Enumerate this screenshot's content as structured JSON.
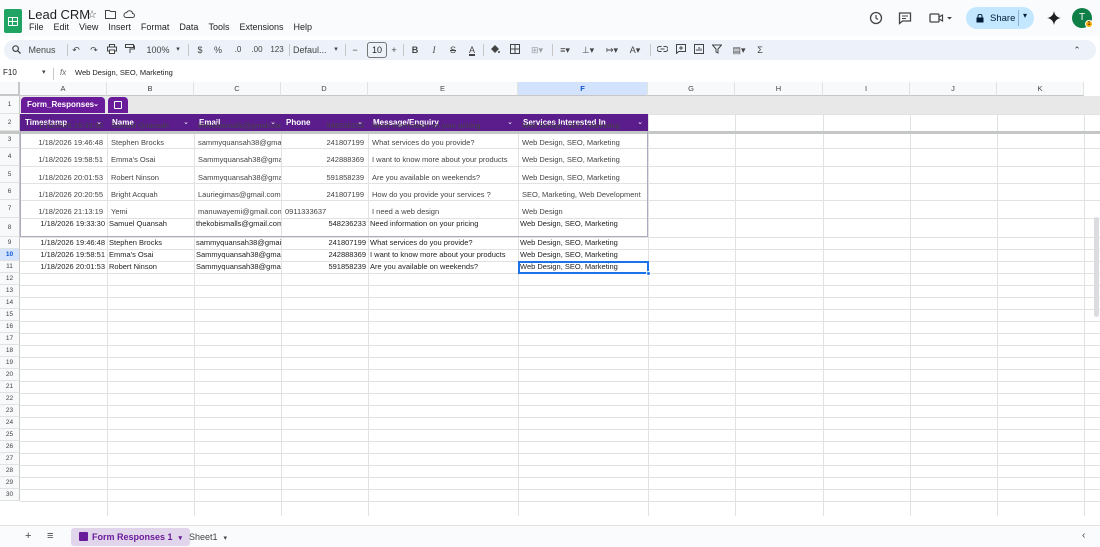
{
  "app": {
    "doc_title": "Lead CRM",
    "menu": [
      "File",
      "Edit",
      "View",
      "Insert",
      "Format",
      "Data",
      "Tools",
      "Extensions",
      "Help"
    ],
    "share_label": "Share",
    "avatar_letter": "T",
    "avatar_badge": "1"
  },
  "toolbar": {
    "menus_label": "Menus",
    "zoom": "100%",
    "currency": "$",
    "percent": "%",
    "dec_decrease": ".0",
    "dec_increase": ".00",
    "number_format": "123",
    "font_name": "Defaul...",
    "font_size": "10",
    "bold": "B",
    "italic": "I",
    "strike": "S",
    "text_color": "A",
    "sum": "Σ"
  },
  "formula_bar": {
    "cell_ref": "F10",
    "fx": "fx",
    "value": "Web Design, SEO, Marketing"
  },
  "columns": [
    "A",
    "B",
    "C",
    "D",
    "E",
    "F",
    "G",
    "H",
    "I",
    "J",
    "K"
  ],
  "selected_column": "F",
  "selected_row": "10",
  "table": {
    "name": "Form_Responses",
    "headers": [
      "Timestamp",
      "Name",
      "Email",
      "Phone",
      "Message/Enquiry",
      "Services Interested In"
    ],
    "rows": [
      [
        "1/18/2026 19:33:30",
        "Samuel Quansah",
        "thekobismalls@gmail.com",
        "548236233",
        "Need information on your pricing",
        "Web Design, SEO, Marketing"
      ],
      [
        "1/18/2026 19:46:48",
        "Stephen Brocks",
        "sammyquansah38@gmail.com",
        "241807199",
        "What services do you provide?",
        "Web Design, SEO, Marketing"
      ],
      [
        "1/18/2026 19:58:51",
        "Emma's Osai",
        "Sammyquansah38@gmail.com",
        "242888369",
        "I want to know more about your products",
        "Web Design, SEO, Marketing"
      ],
      [
        "1/18/2026 20:01:53",
        "Robert Ninson",
        "Sammyquansah38@gmail.com",
        "591858239",
        "Are you available on weekends?",
        "Web Design, SEO, Marketing"
      ],
      [
        "1/18/2026 20:20:55",
        "Bright Acquah",
        "Lauriegimas@gmail.com",
        "241807199",
        "How do you provide your services ?",
        "SEO, Marketing, Web Development"
      ],
      [
        "1/18/2026 21:13:19",
        "Yemi",
        "manuwayemi@gmail.com",
        "0911333637",
        "I need a web design",
        "Web Design"
      ]
    ]
  },
  "plain_rows": [
    [
      "1/18/2026 19:33:30",
      "Samuel Quansah",
      "thekobismalls@gmail.com",
      "548236233",
      "Need information on your pricing",
      "Web Design, SEO, Marketing"
    ],
    [
      "1/18/2026 19:46:48",
      "Stephen Brocks",
      "sammyquansah38@gmail.com",
      "241807199",
      "What services do you provide?",
      "Web Design, SEO, Marketing"
    ],
    [
      "1/18/2026 19:58:51",
      "Emma's Osai",
      "Sammyquansah38@gmail.com",
      "242888369",
      "I want to know more about your products",
      "Web Design, SEO, Marketing"
    ],
    [
      "1/18/2026 20:01:53",
      "Robert Ninson",
      "Sammyquansah38@gmail.com",
      "591858239",
      "Are you available on weekends?",
      "Web Design, SEO, Marketing"
    ]
  ],
  "row_numbers": [
    "1",
    "2",
    "3",
    "4",
    "5",
    "6",
    "7",
    "8",
    "9",
    "10",
    "11",
    "12",
    "13",
    "14",
    "15",
    "16",
    "17",
    "18",
    "19",
    "20",
    "21",
    "22",
    "23",
    "24",
    "25",
    "26",
    "27",
    "28",
    "29",
    "30"
  ],
  "sheets": {
    "add": "+",
    "list": "≡",
    "tabs": [
      "Form Responses 1",
      "Sheet1"
    ],
    "active": "Form Responses 1"
  },
  "colors": {
    "table_header": "#5b1d8c",
    "table_chip": "#6a1b9a",
    "selection": "#1a73e8",
    "share_bg": "#c2e7ff"
  }
}
